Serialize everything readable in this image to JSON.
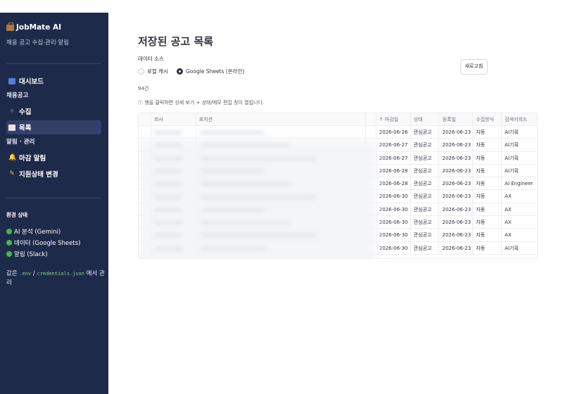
{
  "sidebar": {
    "brand": "JobMate AI",
    "tagline": "채용 공고 수집·관리·알림",
    "nav": {
      "dashboard": "대시보드",
      "section_jobs": "채용공고",
      "collect": "수집",
      "list": "목록",
      "section_alerts": "알림 · 관리",
      "deadline_alert": "마감 알림",
      "status_change": "지원상태 변경"
    },
    "env": {
      "title": "환경 상태",
      "items": [
        "AI 분석 (Gemini)",
        "데이터 (Google Sheets)",
        "알림 (Slack)"
      ],
      "note_prefix": "값은",
      "note_env": ".env",
      "note_sep": "/",
      "note_cred": "credentials.json",
      "note_suffix": "에서 관리"
    }
  },
  "main": {
    "title": "저장된 공고 목록",
    "source_label": "데이터 소스",
    "source_options": [
      "로컬 캐시",
      "Google Sheets (온라인)"
    ],
    "refresh_label": "새로고침",
    "count": "94건",
    "hint": "ⓘ 행을 클릭하면 상세 보기 + 상태/메모 편집 창이 열립니다."
  },
  "table": {
    "headers": [
      "",
      "회사",
      "포지션",
      "",
      "↑ 마감일",
      "상태",
      "등록일",
      "수집방식",
      "검색키워드"
    ],
    "rows": [
      [
        "2026-06-26",
        "관심공고",
        "2026-06-23",
        "자동",
        "AI기획"
      ],
      [
        "2026-06-27",
        "관심공고",
        "2026-06-23",
        "자동",
        "AI기획"
      ],
      [
        "2026-06-27",
        "관심공고",
        "2026-06-23",
        "자동",
        "AI기획"
      ],
      [
        "2026-06-28",
        "관심공고",
        "2026-06-23",
        "자동",
        "AI기획"
      ],
      [
        "2026-06-28",
        "관심공고",
        "2026-06-23",
        "자동",
        "AI Engineer"
      ],
      [
        "2026-06-30",
        "관심공고",
        "2026-06-23",
        "자동",
        "AX"
      ],
      [
        "2026-06-30",
        "관심공고",
        "2026-06-23",
        "자동",
        "AX"
      ],
      [
        "2026-06-30",
        "관심공고",
        "2026-06-23",
        "자동",
        "AX"
      ],
      [
        "2026-06-30",
        "관심공고",
        "2026-06-23",
        "자동",
        "AX"
      ],
      [
        "2026-06-30",
        "관심공고",
        "2026-06-23",
        "자동",
        "AI기획"
      ]
    ]
  },
  "colors": {
    "sidebar_bg": "#1e2a4a",
    "status_ok": "#3fb950"
  }
}
